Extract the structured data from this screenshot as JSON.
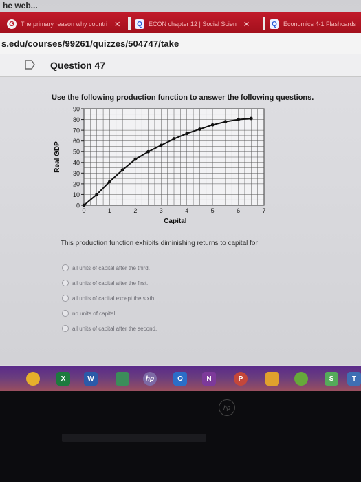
{
  "browser": {
    "partial_title": "he web...",
    "tabs": [
      {
        "label": "The primary reason why countri",
        "icon": "google-icon"
      },
      {
        "label": "ECON chapter 12 | Social Scien",
        "icon": "quizlet-icon"
      },
      {
        "label": "Economics 4-1 Flashcards",
        "icon": "quizlet-icon"
      }
    ],
    "url": "s.edu/courses/99261/quizzes/504747/take"
  },
  "question": {
    "title": "Question 47",
    "instruction": "Use the following production function to answer the following questions.",
    "prompt": "This production function exhibits diminishing returns to capital for",
    "options": [
      "all units of capital after the third.",
      "all units of capital after the first.",
      "all units of capital except the sixth.",
      "no units of capital.",
      "all units of capital after the second."
    ]
  },
  "chart_data": {
    "type": "line",
    "xlabel": "Capital",
    "ylabel": "Real GDP",
    "x": [
      0,
      1,
      2,
      3,
      4,
      5,
      6,
      7
    ],
    "x_ticks": [
      "0",
      "1",
      "2",
      "3",
      "4",
      "5",
      "6",
      "7"
    ],
    "y_ticks": [
      "0",
      "10",
      "20",
      "30",
      "40",
      "50",
      "60",
      "70",
      "80",
      "90"
    ],
    "xlim": [
      0,
      7
    ],
    "ylim": [
      0,
      90
    ],
    "grid": true,
    "series": [
      {
        "points": [
          [
            0,
            0
          ],
          [
            0.5,
            10
          ],
          [
            1,
            22
          ],
          [
            1.5,
            33
          ],
          [
            2,
            43
          ],
          [
            2.5,
            50
          ],
          [
            3,
            56
          ],
          [
            3.5,
            62
          ],
          [
            4,
            67
          ],
          [
            4.5,
            71
          ],
          [
            5,
            75
          ],
          [
            5.5,
            78
          ],
          [
            6,
            80
          ],
          [
            6.5,
            81
          ]
        ],
        "color": "#111111"
      }
    ]
  },
  "taskbar": {
    "icons": [
      {
        "name": "chrome-icon",
        "label": ""
      },
      {
        "name": "excel-icon",
        "label": "X"
      },
      {
        "name": "word-icon",
        "label": "W"
      },
      {
        "name": "store-icon",
        "label": ""
      },
      {
        "name": "hp-icon",
        "label": "hp"
      },
      {
        "name": "outlook-icon",
        "label": "O"
      },
      {
        "name": "onenote-icon",
        "label": "N"
      },
      {
        "name": "powerpoint-icon",
        "label": "P"
      },
      {
        "name": "app-icon",
        "label": ""
      },
      {
        "name": "wifi-icon",
        "label": ""
      },
      {
        "name": "s-app-icon",
        "label": "S"
      },
      {
        "name": "t-app-icon",
        "label": "T"
      }
    ]
  }
}
